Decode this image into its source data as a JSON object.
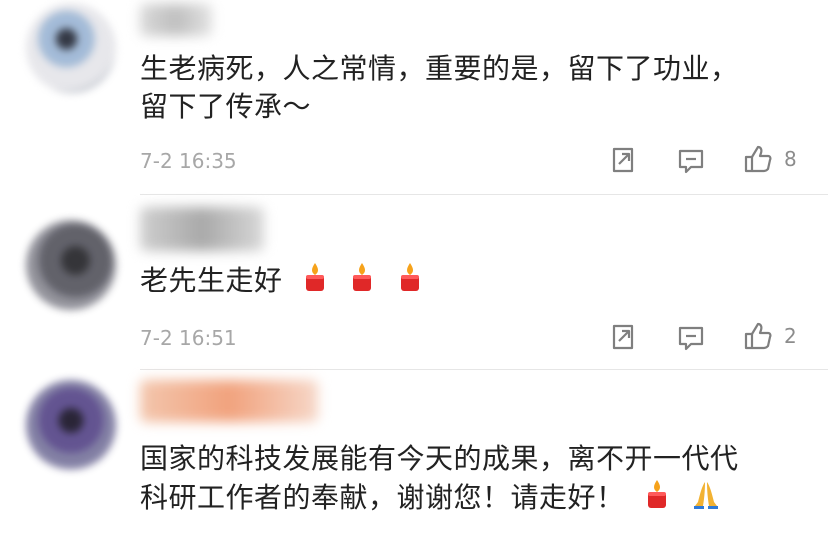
{
  "comments": [
    {
      "text_lines": [
        "生老病死，人之常情，重要的是，留下了功业，",
        "留下了传承～"
      ],
      "time": "7-2 16:35",
      "likes": "8"
    },
    {
      "text_lines": [
        "老先生走好"
      ],
      "time": "7-2 16:51",
      "likes": "2"
    },
    {
      "text_lines": [
        "国家的科技发展能有今天的成果，离不开一代代",
        "科研工作者的奉献，谢谢您！请走好！"
      ],
      "time": "",
      "likes": ""
    }
  ],
  "icons": {
    "share": "share-icon",
    "comment": "comment-icon",
    "like": "thumbs-up-icon",
    "candle": "candle-icon",
    "pray": "praying-hands-icon"
  },
  "colors": {
    "text": "#222222",
    "meta": "#a7a7a7",
    "icon": "#7f7f7f",
    "divider": "#e6e6e6"
  }
}
